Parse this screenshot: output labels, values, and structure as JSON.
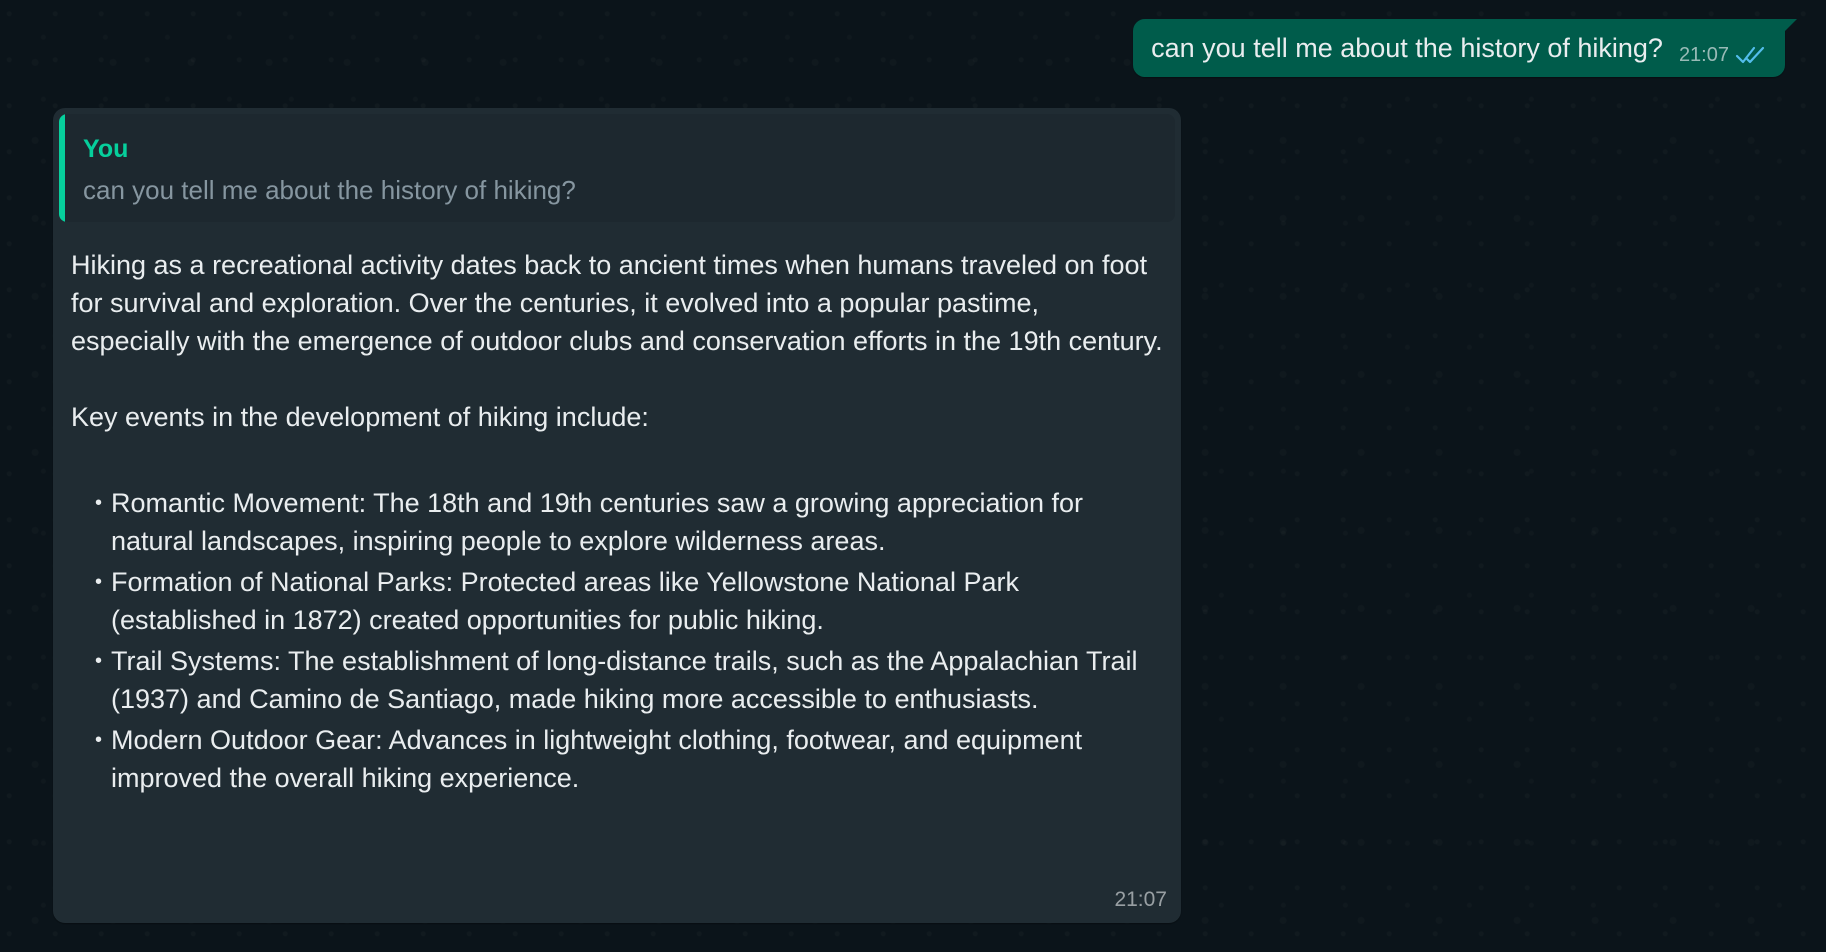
{
  "outgoing": {
    "text": "can you tell me about the history of hiking?",
    "time": "21:07",
    "status_icon": "double-check-icon",
    "status_color": "#53bdeb"
  },
  "incoming": {
    "quote": {
      "author": "You",
      "text": "can you tell me about the history of hiking?"
    },
    "paragraphs": [
      "Hiking as a recreational activity dates back to ancient times when humans traveled on foot for survival and exploration. Over the centuries, it evolved into a popular pastime, especially with the emergence of outdoor clubs and conservation efforts in the 19th century.",
      "Key events in the development of hiking include:"
    ],
    "bullet_char": "•",
    "events": [
      "Romantic Movement: The 18th and 19th centuries saw a growing appreciation for natural landscapes, inspiring people to explore wilderness areas.",
      "Formation of National Parks: Protected areas like Yellowstone National Park (established in 1872) created opportunities for public hiking.",
      "Trail Systems: The establishment of long-distance trails, such as the Appalachian Trail (1937) and Camino de Santiago, made hiking more accessible to enthusiasts.",
      "Modern Outdoor Gear: Advances in lightweight clothing, footwear, and equipment improved the overall hiking experience."
    ],
    "time": "21:07"
  },
  "colors": {
    "background": "#0b141a",
    "outgoing_bubble": "#005c4b",
    "incoming_bubble": "#202c33",
    "quote_accent": "#06cf9c"
  }
}
